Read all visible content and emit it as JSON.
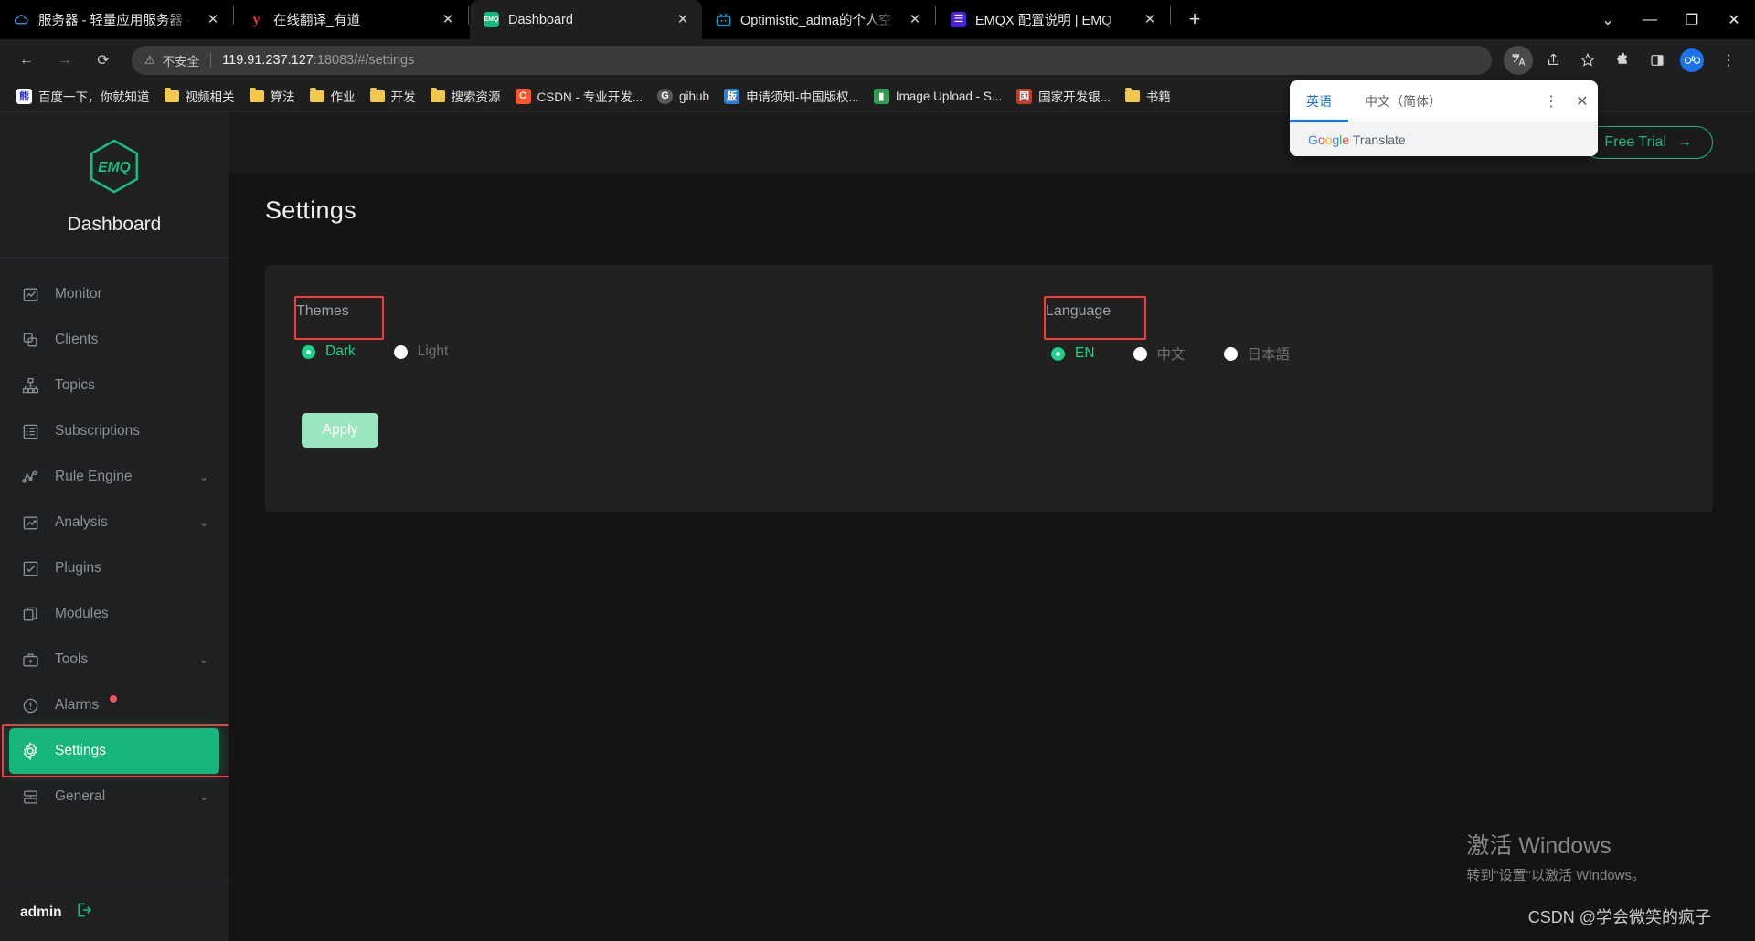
{
  "browser": {
    "tabs": [
      {
        "title": "服务器 - 轻量应用服务器 - 控制台",
        "icon": "cloud-icon",
        "active": false
      },
      {
        "title": "在线翻译_有道",
        "icon": "youdao-icon",
        "active": false
      },
      {
        "title": "Dashboard",
        "icon": "emq-icon",
        "active": true
      },
      {
        "title": "Optimistic_adma的个人空间_哔",
        "icon": "bilibili-icon",
        "active": false
      },
      {
        "title": "EMQX 配置说明 | EMQ",
        "icon": "emqx-doc-icon",
        "active": false
      }
    ],
    "new_tab_label": "+",
    "close_label": "✕",
    "window_controls": {
      "more": "⌄",
      "minimize": "—",
      "maximize": "❐",
      "close": "✕"
    },
    "toolbar": {
      "back": "←",
      "forward": "→",
      "reload": "⟳",
      "security_text": "不安全",
      "url_host": "119.91.237.127",
      "url_rest": ":18083/#/settings",
      "translate_icon": "translate-icon",
      "share_icon": "share-icon",
      "bookmark_icon": "star-icon",
      "extensions_icon": "puzzle-icon",
      "sidepanel_icon": "side-panel-icon",
      "profile_icon": "profile-avatar",
      "menu_icon": "three-dot-menu-icon"
    },
    "bookmarks": [
      {
        "label": "百度一下，你就知道",
        "icon": "baidu-icon",
        "color": "#ffffff"
      },
      {
        "label": "视频相关",
        "icon": "folder-icon"
      },
      {
        "label": "算法",
        "icon": "folder-icon"
      },
      {
        "label": "作业",
        "icon": "folder-icon"
      },
      {
        "label": "开发",
        "icon": "folder-icon"
      },
      {
        "label": "搜索资源",
        "icon": "folder-icon"
      },
      {
        "label": "CSDN - 专业开发...",
        "icon": "csdn-icon",
        "color": "#fc5531"
      },
      {
        "label": "gihub",
        "icon": "github-icon",
        "color": "#5a5a5a"
      },
      {
        "label": "申请须知-中国版权...",
        "icon": "copyright-icon",
        "color": "#2f7fd1"
      },
      {
        "label": "Image Upload - S...",
        "icon": "image-upload-icon",
        "color": "#2e9e4f"
      },
      {
        "label": "国家开发银...",
        "icon": "bank-icon",
        "color": "#c63a2a"
      },
      {
        "label": "书籍",
        "icon": "folder-icon"
      }
    ]
  },
  "translate_popup": {
    "tab_english": "英语",
    "tab_chinese": "中文（简体）",
    "menu_icon": "three-dot-menu-icon",
    "close_icon": "close-icon",
    "brand": {
      "g": "G",
      "o1": "o",
      "o2": "o",
      "g2": "g",
      "l": "l",
      "e": "e",
      "word": "Translate"
    }
  },
  "sidebar": {
    "brand_name": "Dashboard",
    "logo": "emq-logo",
    "items": [
      {
        "label": "Monitor",
        "icon": "monitor-icon",
        "chevron": false,
        "active": false
      },
      {
        "label": "Clients",
        "icon": "clients-icon",
        "chevron": false,
        "active": false
      },
      {
        "label": "Topics",
        "icon": "topics-icon",
        "chevron": false,
        "active": false
      },
      {
        "label": "Subscriptions",
        "icon": "subscriptions-icon",
        "chevron": false,
        "active": false
      },
      {
        "label": "Rule Engine",
        "icon": "rule-engine-icon",
        "chevron": true,
        "active": false
      },
      {
        "label": "Analysis",
        "icon": "analysis-icon",
        "chevron": true,
        "active": false
      },
      {
        "label": "Plugins",
        "icon": "plugins-icon",
        "chevron": false,
        "active": false
      },
      {
        "label": "Modules",
        "icon": "modules-icon",
        "chevron": false,
        "active": false
      },
      {
        "label": "Tools",
        "icon": "tools-icon",
        "chevron": true,
        "active": false
      },
      {
        "label": "Alarms",
        "icon": "alarms-icon",
        "chevron": false,
        "active": false,
        "badge": true
      },
      {
        "label": "Settings",
        "icon": "gear-icon",
        "chevron": false,
        "active": true
      },
      {
        "label": "General",
        "icon": "general-icon",
        "chevron": true,
        "active": false
      }
    ],
    "user": "admin",
    "logout_icon": "logout-icon"
  },
  "main": {
    "free_trial_label": "Free Trial",
    "free_trial_arrow": "→",
    "page_title": "Settings",
    "themes": {
      "label": "Themes",
      "options": [
        {
          "label": "Dark",
          "selected": true
        },
        {
          "label": "Light",
          "selected": false
        }
      ]
    },
    "language": {
      "label": "Language",
      "options": [
        {
          "label": "EN",
          "selected": true
        },
        {
          "label": "中文",
          "selected": false
        },
        {
          "label": "日本語",
          "selected": false
        }
      ]
    },
    "apply_label": "Apply"
  },
  "watermark": {
    "line1": "激活 Windows",
    "line2": "转到\"设置\"以激活 Windows。",
    "credit": "CSDN @学会微笑的疯子"
  },
  "colors": {
    "accent_green": "#17b77c",
    "radio_green": "#17d486",
    "highlight_red": "#fb3b3b",
    "sidebar_bg": "#1f2022",
    "card_bg": "#212121"
  }
}
